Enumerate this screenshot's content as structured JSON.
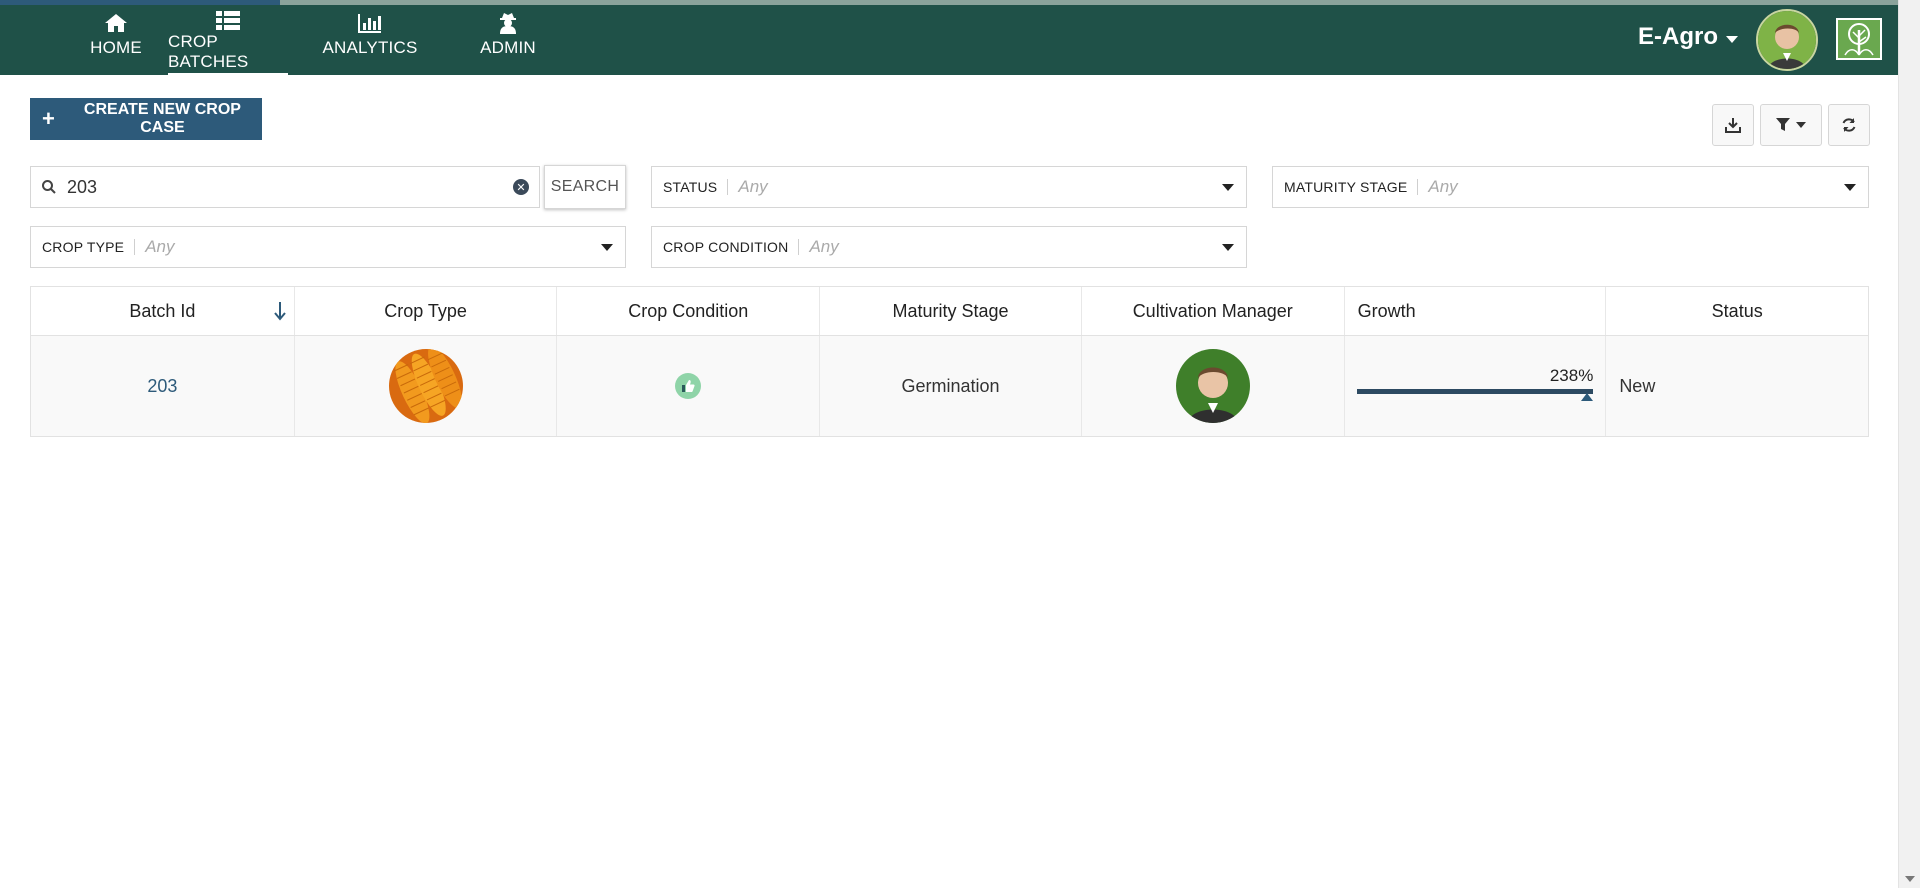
{
  "nav": {
    "items": [
      {
        "label": "HOME",
        "icon": "home-icon",
        "active": false
      },
      {
        "label": "CROP BATCHES",
        "icon": "list-icon",
        "active": true
      },
      {
        "label": "ANALYTICS",
        "icon": "bar-chart-icon",
        "active": false
      },
      {
        "label": "ADMIN",
        "icon": "user-secret-icon",
        "active": false
      }
    ],
    "brand": "E-Agro",
    "colors": {
      "navbar": "#1f5148",
      "primary": "#2d5a7a"
    }
  },
  "actions": {
    "create_label": "CREATE NEW CROP CASE"
  },
  "search": {
    "value": "203",
    "button_label": "SEARCH"
  },
  "filters": {
    "status": {
      "label": "STATUS",
      "value": "Any"
    },
    "maturity_stage": {
      "label": "MATURITY STAGE",
      "value": "Any"
    },
    "crop_type": {
      "label": "CROP TYPE",
      "value": "Any"
    },
    "crop_condition": {
      "label": "CROP CONDITION",
      "value": "Any"
    }
  },
  "table": {
    "columns": [
      "Batch Id",
      "Crop Type",
      "Crop Condition",
      "Maturity Stage",
      "Cultivation Manager",
      "Growth",
      "Status"
    ],
    "rows": [
      {
        "batch_id": "203",
        "crop_type_image": "corn",
        "crop_condition_icon": "thumbs-up-icon",
        "maturity_stage": "Germination",
        "cultivation_manager_image": "manager-avatar",
        "growth": "238%",
        "status": "New"
      }
    ]
  }
}
